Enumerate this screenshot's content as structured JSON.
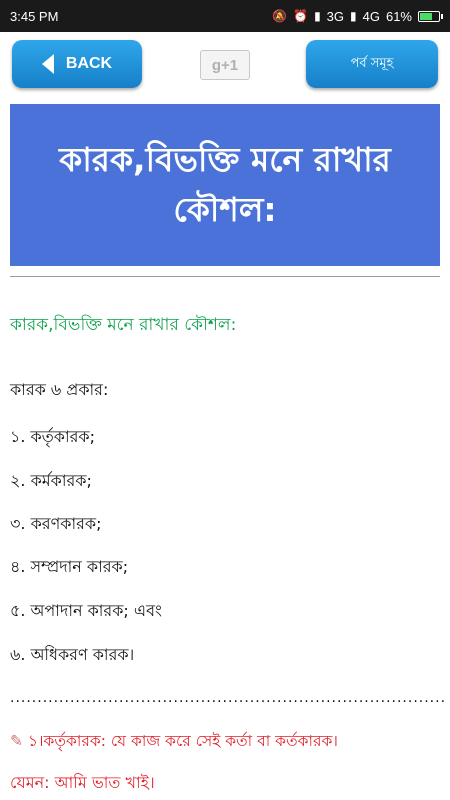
{
  "status_bar": {
    "time": "3:45 PM",
    "network_3g": "3G",
    "network_4g": "4G",
    "battery_percent": "61%",
    "icons": [
      "mute-icon",
      "alarm-icon",
      "signal-icon",
      "battery-charging-icon"
    ]
  },
  "toolbar": {
    "back_label": "BACK",
    "gplus_label": "g+1",
    "parbo_label": "পর্ব সমূহ",
    "accent_color": "#1a8fd8"
  },
  "heading": {
    "title": "কারক,বিভক্তি মনে রাখার কৌশল:",
    "background": "#4a72d8"
  },
  "content": {
    "subtitle": "কারক,বিভক্তি মনে রাখার কৌশল:",
    "list_heading": "কারক ৬ প্রকার:",
    "items": [
      "১. কর্তৃকারক;",
      "২. কর্মকারক;",
      "৩. করণকারক;",
      "৪. সম্প্রদান কারক;",
      "৫. অপাদান কারক; এবং",
      "৬. অধিকরণ কারক।"
    ],
    "separator": "................................................................................",
    "red_line_1": "১।কর্তৃকারক: যে কাজ করে সেই কর্তা বা কর্তকারক।",
    "red_line_2": "যেমন: আমি ভাত খাই।"
  }
}
